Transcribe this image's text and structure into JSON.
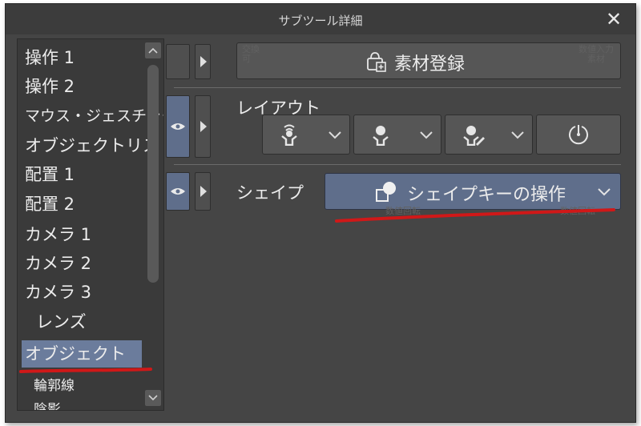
{
  "window": {
    "title": "サブツール詳細"
  },
  "sidebar": {
    "items": [
      {
        "label": "操作 1"
      },
      {
        "label": "操作 2"
      },
      {
        "label": "マウス・ジェスチャー"
      },
      {
        "label": "オブジェクトリスト"
      },
      {
        "label": "配置 1"
      },
      {
        "label": "配置 2"
      },
      {
        "label": "カメラ 1"
      },
      {
        "label": "カメラ 2"
      },
      {
        "label": "カメラ 3"
      },
      {
        "label": "レンズ"
      },
      {
        "label": "オブジェクト",
        "selected": true
      },
      {
        "label": "輪郭線"
      },
      {
        "label": "陰影"
      }
    ]
  },
  "rows": {
    "material": {
      "button_label": "素材登録",
      "faint_left": "交換\n可",
      "faint_right": "数値入力\n素材"
    },
    "layout": {
      "label": "レイアウト"
    },
    "shape": {
      "label": "シェイプ",
      "dropdown_label": "シェイプキーの操作",
      "faint_left": "数値回転",
      "faint_right": "数値回転"
    }
  },
  "colors": {
    "accent": "#6b7c9c",
    "annotation": "#d01818"
  }
}
